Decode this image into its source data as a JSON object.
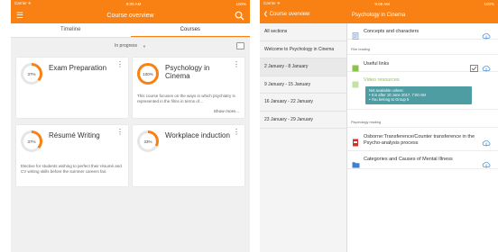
{
  "left": {
    "status": {
      "carrier": "Carrier ✈",
      "time": "9:08 AM",
      "battery": "100%"
    },
    "nav": {
      "title": "Course overview"
    },
    "tabs": [
      {
        "label": "Timeline",
        "active": false
      },
      {
        "label": "Courses",
        "active": true
      }
    ],
    "filter": {
      "label": "In progress"
    },
    "courses": [
      {
        "title": "Exam Preparation",
        "progress": 37,
        "progress_label": "37%",
        "description": "",
        "more": ""
      },
      {
        "title": "Psychology in Cinema",
        "progress": 100,
        "progress_label": "100%",
        "description": "This course focuses on the ways in which psychiatry is represented in the films in terms of…",
        "more": "Show more..."
      },
      {
        "title": "Résumé Writing",
        "progress": 37,
        "progress_label": "37%",
        "description": "Elective for students wishing to perfect their résumé and CV writing skills before the summer careers fair.",
        "more": ""
      },
      {
        "title": "Workplace induction",
        "progress": 33,
        "progress_label": "33%",
        "description": "",
        "more": ""
      }
    ]
  },
  "right": {
    "status": {
      "carrier": "Carrier ✈",
      "time": "9:08 AM",
      "battery": "100%"
    },
    "nav": {
      "back": "Course overview",
      "title": "Psychology in Cinema"
    },
    "sections": [
      {
        "label": "All sections",
        "active": false
      },
      {
        "label": "Welcome to Psychology in Cinema",
        "active": false
      },
      {
        "label": "2 January - 8 January",
        "active": true
      },
      {
        "label": "9 January - 15 January",
        "active": false
      },
      {
        "label": "16 January - 22 January",
        "active": false
      },
      {
        "label": "23 January - 29 January",
        "active": false
      }
    ],
    "content": {
      "item1": "Concepts and characters",
      "header1": "Film reading",
      "item2": "Useful links",
      "item3": "Video resources",
      "restriction": {
        "title": "Not available unless:",
        "line1": "• It is after 10 June 2017, 7:00 AM",
        "line2": "• You belong to Group 5"
      },
      "header2": "Psychology reading",
      "item4": "Osborne:Transference/Counter transference in the Psycho-analysis process",
      "item5": "Categories and Causes of Mental Illness"
    }
  },
  "colors": {
    "accent": "#f98012",
    "teal": "#4d9da3",
    "restricted_icon": "#8bc34a",
    "pdf": "#d32f2f",
    "folder": "#3f7fd0",
    "link_icon": "#8bc34a"
  }
}
